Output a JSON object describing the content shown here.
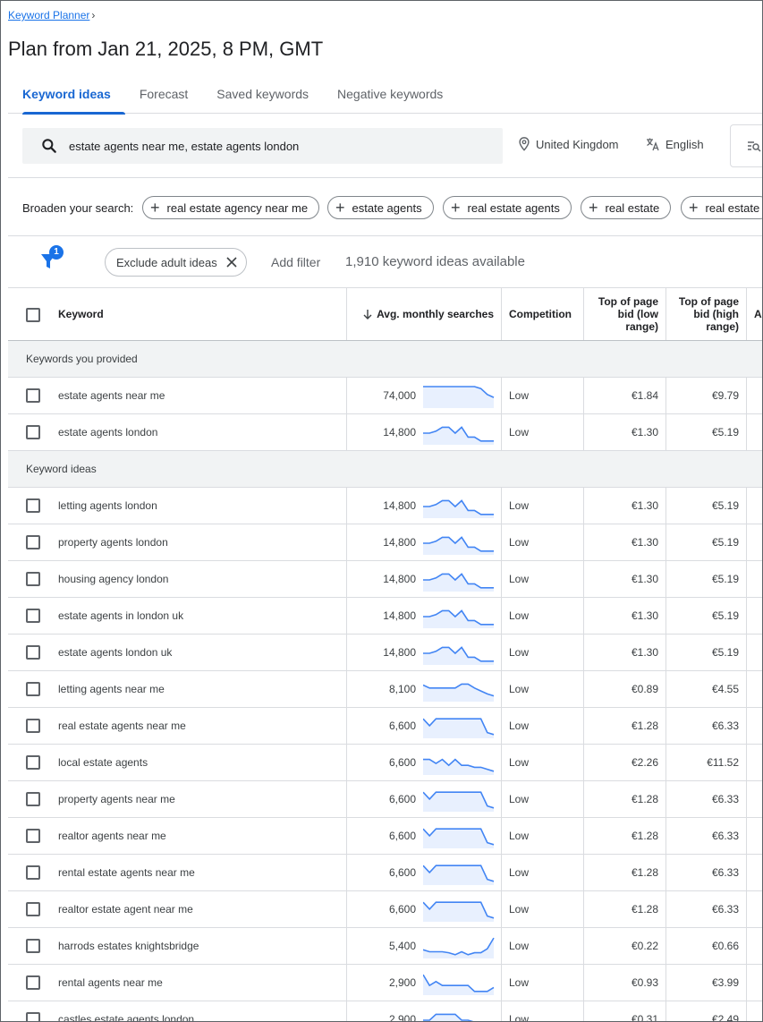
{
  "breadcrumb": {
    "label": "Keyword Planner",
    "chevron": "›"
  },
  "page_title": "Plan from Jan 21, 2025, 8 PM, GMT",
  "tabs": [
    {
      "label": "Keyword ideas",
      "active": true
    },
    {
      "label": "Forecast",
      "active": false
    },
    {
      "label": "Saved keywords",
      "active": false
    },
    {
      "label": "Negative keywords",
      "active": false
    }
  ],
  "search": {
    "value": "estate agents near me, estate agents london",
    "location": "United Kingdom",
    "language": "English"
  },
  "broaden": {
    "label": "Broaden your search:",
    "chips": [
      "real estate agency near me",
      "estate agents",
      "real estate agents",
      "real estate",
      "real estate"
    ]
  },
  "filters": {
    "badge_count": "1",
    "exclude_chip": "Exclude adult ideas",
    "add_filter": "Add filter",
    "available": "1,910 keyword ideas available"
  },
  "table": {
    "headers": {
      "keyword": "Keyword",
      "avg": "Avg. monthly searches",
      "competition": "Competition",
      "low_line1": "Top of page",
      "low_line2": "bid (low",
      "low_line3": "range)",
      "high_line1": "Top of page",
      "high_line2": "bid (high",
      "high_line3": "range)",
      "ad": "Ad"
    },
    "sections": [
      {
        "title": "Keywords you provided",
        "rows": [
          {
            "keyword": "estate agents near me",
            "avg": "74,000",
            "trend": [
              1,
              1,
              1,
              1,
              1,
              1,
              1,
              1,
              1,
              0.9,
              0.6,
              0.45
            ],
            "competition": "Low",
            "low": "€1.84",
            "high": "€9.79"
          },
          {
            "keyword": "estate agents london",
            "avg": "14,800",
            "trend": [
              0.5,
              0.5,
              0.6,
              0.8,
              0.8,
              0.5,
              0.8,
              0.3,
              0.3,
              0.1,
              0.1,
              0.1
            ],
            "competition": "Low",
            "low": "€1.30",
            "high": "€5.19"
          }
        ]
      },
      {
        "title": "Keyword ideas",
        "rows": [
          {
            "keyword": "letting agents london",
            "avg": "14,800",
            "trend": [
              0.5,
              0.5,
              0.6,
              0.8,
              0.8,
              0.5,
              0.8,
              0.3,
              0.3,
              0.1,
              0.1,
              0.1
            ],
            "competition": "Low",
            "low": "€1.30",
            "high": "€5.19"
          },
          {
            "keyword": "property agents london",
            "avg": "14,800",
            "trend": [
              0.5,
              0.5,
              0.6,
              0.8,
              0.8,
              0.5,
              0.8,
              0.3,
              0.3,
              0.1,
              0.1,
              0.1
            ],
            "competition": "Low",
            "low": "€1.30",
            "high": "€5.19"
          },
          {
            "keyword": "housing agency london",
            "avg": "14,800",
            "trend": [
              0.5,
              0.5,
              0.6,
              0.8,
              0.8,
              0.5,
              0.8,
              0.3,
              0.3,
              0.1,
              0.1,
              0.1
            ],
            "competition": "Low",
            "low": "€1.30",
            "high": "€5.19"
          },
          {
            "keyword": "estate agents in london uk",
            "avg": "14,800",
            "trend": [
              0.5,
              0.5,
              0.6,
              0.8,
              0.8,
              0.5,
              0.8,
              0.3,
              0.3,
              0.1,
              0.1,
              0.1
            ],
            "competition": "Low",
            "low": "€1.30",
            "high": "€5.19"
          },
          {
            "keyword": "estate agents london uk",
            "avg": "14,800",
            "trend": [
              0.5,
              0.5,
              0.6,
              0.8,
              0.8,
              0.5,
              0.8,
              0.3,
              0.3,
              0.1,
              0.1,
              0.1
            ],
            "competition": "Low",
            "low": "€1.30",
            "high": "€5.19"
          },
          {
            "keyword": "letting agents near me",
            "avg": "8,100",
            "trend": [
              0.75,
              0.6,
              0.6,
              0.6,
              0.6,
              0.6,
              0.8,
              0.8,
              0.6,
              0.45,
              0.3,
              0.2
            ],
            "competition": "Low",
            "low": "€0.89",
            "high": "€4.55"
          },
          {
            "keyword": "real estate agents near me",
            "avg": "6,600",
            "trend": [
              0.9,
              0.55,
              0.9,
              0.9,
              0.9,
              0.9,
              0.9,
              0.9,
              0.9,
              0.9,
              0.2,
              0.1
            ],
            "competition": "Low",
            "low": "€1.28",
            "high": "€6.33"
          },
          {
            "keyword": "local estate agents",
            "avg": "6,600",
            "trend": [
              0.7,
              0.7,
              0.5,
              0.7,
              0.4,
              0.7,
              0.4,
              0.4,
              0.3,
              0.3,
              0.2,
              0.1
            ],
            "competition": "Low",
            "low": "€2.26",
            "high": "€11.52"
          },
          {
            "keyword": "property agents near me",
            "avg": "6,600",
            "trend": [
              0.9,
              0.55,
              0.9,
              0.9,
              0.9,
              0.9,
              0.9,
              0.9,
              0.9,
              0.9,
              0.2,
              0.1
            ],
            "competition": "Low",
            "low": "€1.28",
            "high": "€6.33"
          },
          {
            "keyword": "realtor agents near me",
            "avg": "6,600",
            "trend": [
              0.9,
              0.55,
              0.9,
              0.9,
              0.9,
              0.9,
              0.9,
              0.9,
              0.9,
              0.9,
              0.2,
              0.1
            ],
            "competition": "Low",
            "low": "€1.28",
            "high": "€6.33"
          },
          {
            "keyword": "rental estate agents near me",
            "avg": "6,600",
            "trend": [
              0.9,
              0.55,
              0.9,
              0.9,
              0.9,
              0.9,
              0.9,
              0.9,
              0.9,
              0.9,
              0.2,
              0.1
            ],
            "competition": "Low",
            "low": "€1.28",
            "high": "€6.33"
          },
          {
            "keyword": "realtor estate agent near me",
            "avg": "6,600",
            "trend": [
              0.9,
              0.55,
              0.9,
              0.9,
              0.9,
              0.9,
              0.9,
              0.9,
              0.9,
              0.9,
              0.2,
              0.1
            ],
            "competition": "Low",
            "low": "€1.28",
            "high": "€6.33"
          },
          {
            "keyword": "harrods estates knightsbridge",
            "avg": "5,400",
            "trend": [
              0.35,
              0.25,
              0.25,
              0.25,
              0.2,
              0.1,
              0.25,
              0.1,
              0.2,
              0.2,
              0.4,
              0.95
            ],
            "competition": "Low",
            "low": "€0.22",
            "high": "€0.66"
          },
          {
            "keyword": "rental agents near me",
            "avg": "2,900",
            "trend": [
              0.95,
              0.4,
              0.6,
              0.4,
              0.4,
              0.4,
              0.4,
              0.4,
              0.1,
              0.1,
              0.1,
              0.3
            ],
            "competition": "Low",
            "low": "€0.93",
            "high": "€3.99"
          },
          {
            "keyword": "castles estate agents london",
            "avg": "2,900",
            "trend": [
              0.5,
              0.5,
              0.8,
              0.8,
              0.8,
              0.8,
              0.5,
              0.5,
              0.4,
              0.4,
              0.3,
              0.3
            ],
            "competition": "Low",
            "low": "€0.31",
            "high": "€2.49"
          }
        ]
      }
    ]
  },
  "colors": {
    "accent": "#1a73e8",
    "tab_active": "#1967d2",
    "spark_line": "#4285f4",
    "spark_fill": "#e8f0fe"
  }
}
